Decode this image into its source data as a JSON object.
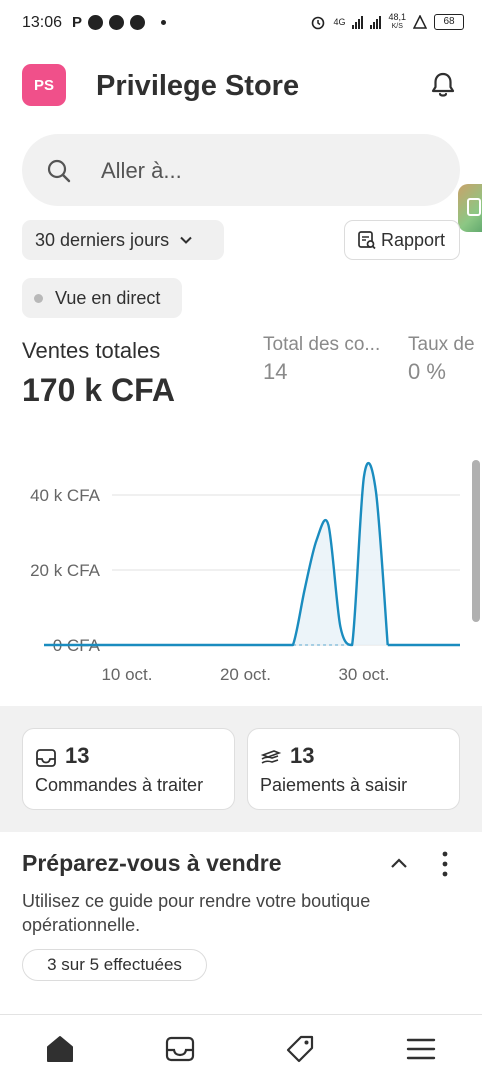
{
  "status_bar": {
    "time": "13:06",
    "left_icons": [
      "p-icon",
      "telegram-icon",
      "telegram-icon",
      "telegram-icon"
    ],
    "right_icons": [
      "alarm-icon",
      "signal-4g-icon",
      "signal-icon",
      "data-speed-icon",
      "warning-icon",
      "battery-icon"
    ],
    "network": "4G",
    "net_speed": "48,1",
    "net_speed_unit": "K/S",
    "battery": "68"
  },
  "header": {
    "avatar_initials": "PS",
    "avatar_color": "#f0508a",
    "title": "Privilege Store",
    "bell_icon": "bell-icon"
  },
  "search": {
    "placeholder": "Aller à..."
  },
  "filters": {
    "date_range": "30 derniers jours",
    "report_label": "Rapport",
    "live_label": "Vue en direct"
  },
  "metrics": {
    "total_sales_label": "Ventes totales",
    "total_sales_value": "170 k CFA",
    "orders_label": "Total des co...",
    "orders_value": "14",
    "rate_label": "Taux de",
    "rate_value": "0 %"
  },
  "chart_data": {
    "type": "line",
    "ylim": [
      0,
      45000
    ],
    "y_tick_labels": [
      "0 CFA",
      "20 k CFA",
      "40 k CFA"
    ],
    "y_ticks": [
      0,
      20000,
      40000
    ],
    "x_tick_labels": [
      "10 oct.",
      "20 oct.",
      "30 oct."
    ],
    "x_tick_days": [
      10,
      20,
      30
    ],
    "grid": true,
    "line_color": "#1a8cbf",
    "series": [
      {
        "x": [
          3,
          4,
          5,
          6,
          7,
          8,
          9,
          10,
          11,
          12,
          13,
          14,
          15,
          16,
          17,
          18,
          19,
          20,
          21,
          22,
          23,
          24,
          25,
          26,
          27,
          28,
          29,
          30,
          31,
          32
        ],
        "y": [
          0,
          0,
          0,
          0,
          0,
          0,
          0,
          0,
          0,
          0,
          0,
          0,
          0,
          0,
          0,
          0,
          0,
          0,
          0,
          0,
          0,
          0,
          15000,
          28000,
          32000,
          5000,
          0,
          45000,
          41000,
          0
        ]
      }
    ]
  },
  "cards": [
    {
      "icon": "inbox-icon",
      "count": "13",
      "label": "Commandes à traiter"
    },
    {
      "icon": "payment-icon",
      "count": "13",
      "label": "Paiements à saisir"
    }
  ],
  "guide": {
    "title": "Préparez-vous à vendre",
    "description": "Utilisez ce guide pour rendre votre boutique opérationnelle.",
    "progress": "3 sur 5 effectuées"
  },
  "bottom_nav": [
    "home-icon",
    "orders-icon",
    "products-tag-icon",
    "menu-icon"
  ]
}
